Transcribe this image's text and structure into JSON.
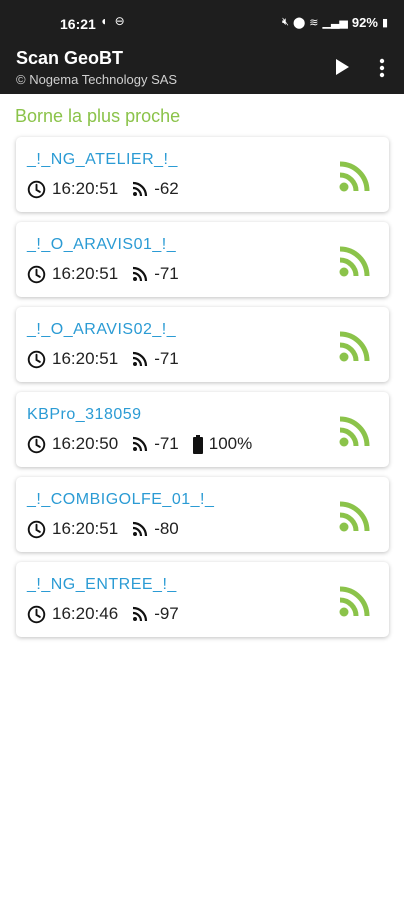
{
  "status_bar": {
    "time": "16:21",
    "battery": "92%"
  },
  "app_bar": {
    "title": "Scan GeoBT",
    "subtitle": "© Nogema Technology SAS"
  },
  "section_title": "Borne la plus proche",
  "colors": {
    "accent_green": "#8bc34a",
    "link_blue": "#2b9bd4",
    "app_bar_bg": "#1e1e1e"
  },
  "devices": [
    {
      "name": "_!_NG_ATELIER_!_",
      "time": "16:20:51",
      "rssi": "-62"
    },
    {
      "name": "_!_O_ARAVIS01_!_",
      "time": "16:20:51",
      "rssi": "-71"
    },
    {
      "name": "_!_O_ARAVIS02_!_",
      "time": "16:20:51",
      "rssi": "-71"
    },
    {
      "name": "KBPro_318059",
      "time": "16:20:50",
      "rssi": "-71",
      "battery": "100%"
    },
    {
      "name": "_!_COMBIGOLFE_01_!_",
      "time": "16:20:51",
      "rssi": "-80"
    },
    {
      "name": "_!_NG_ENTREE_!_",
      "time": "16:20:46",
      "rssi": "-97"
    }
  ]
}
